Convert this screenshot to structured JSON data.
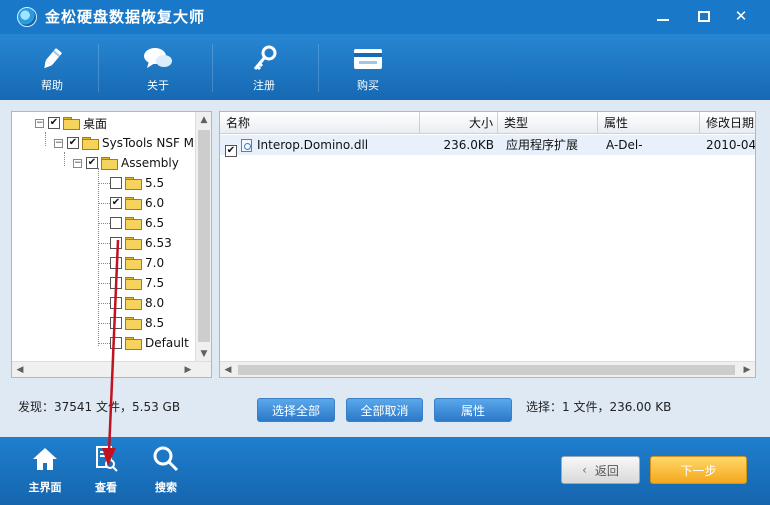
{
  "window": {
    "title": "金松硬盘数据恢复大师",
    "min_symbol": "—",
    "close_symbol": "✕"
  },
  "toolbar": {
    "items": [
      {
        "label": "帮助",
        "icon": "pen-icon"
      },
      {
        "label": "关于",
        "icon": "chat-icon"
      },
      {
        "label": "注册",
        "icon": "key-icon"
      },
      {
        "label": "购买",
        "icon": "card-icon"
      }
    ]
  },
  "tree": {
    "nodes": [
      {
        "label": "桌面",
        "checked": true,
        "expanded": true
      },
      {
        "label": "SysTools NSF M",
        "checked": true,
        "expanded": true
      },
      {
        "label": "Assembly",
        "checked": true,
        "expanded": true
      },
      {
        "label": "5.5",
        "checked": false
      },
      {
        "label": "6.0",
        "checked": true
      },
      {
        "label": "6.5",
        "checked": false
      },
      {
        "label": "6.53",
        "checked": false
      },
      {
        "label": "7.0",
        "checked": false
      },
      {
        "label": "7.5",
        "checked": false
      },
      {
        "label": "8.0",
        "checked": false
      },
      {
        "label": "8.5",
        "checked": false
      },
      {
        "label": "Default",
        "checked": false
      }
    ],
    "expander_symbol": "−",
    "check_mark": "✔"
  },
  "file_list": {
    "columns": [
      "名称",
      "大小",
      "类型",
      "属性",
      "修改日期"
    ],
    "rows": [
      {
        "name": "Interop.Domino.dll",
        "size": "236.0KB",
        "type": "应用程序扩展",
        "attr": "A-Del-",
        "date": "2010-04-",
        "checked": true
      }
    ]
  },
  "status": {
    "found": "发现：37541 文件，5.53 GB",
    "selected": "选择：1 文件，236.00 KB"
  },
  "actions": {
    "select_all": "选择全部",
    "deselect_all": "全部取消",
    "properties": "属性"
  },
  "bottom": {
    "home": "主界面",
    "view": "查看",
    "search": "搜索",
    "back": "返回",
    "next": "下一步"
  },
  "colors": {
    "primary": "#1a78c8",
    "accent": "#f3a81b",
    "annotation": "#c0121f"
  }
}
